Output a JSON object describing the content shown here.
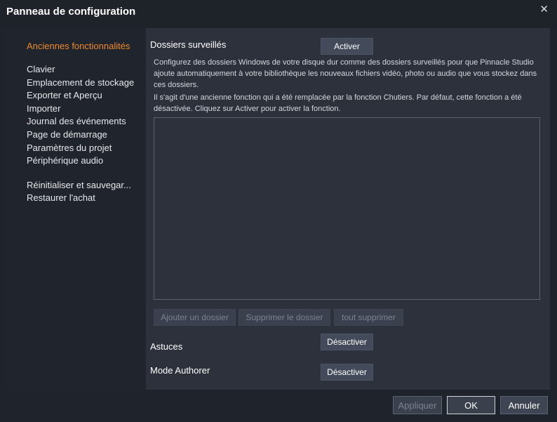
{
  "window": {
    "title": "Panneau de configuration",
    "close_icon": "close-icon"
  },
  "sidebar": {
    "items": [
      {
        "label": "Anciennes fonctionnalités",
        "active": true
      },
      {
        "label": "Clavier"
      },
      {
        "label": "Emplacement de stockage"
      },
      {
        "label": "Exporter et Aperçu"
      },
      {
        "label": "Importer"
      },
      {
        "label": "Journal des événements"
      },
      {
        "label": "Page de démarrage"
      },
      {
        "label": "Paramètres du projet"
      },
      {
        "label": "Périphérique audio"
      },
      {
        "label": "Réinitialiser et sauvegar..."
      },
      {
        "label": "Restaurer l'achat"
      }
    ]
  },
  "watched_folders": {
    "title": "Dossiers surveillés",
    "activate_label": "Activer",
    "description_1": "Configurez des dossiers Windows de votre disque dur comme des dossiers surveillés pour que Pinnacle Studio ajoute automatiquement à votre bibliothèque les nouveaux fichiers vidéo, photo ou audio que vous stockez dans ces dossiers.",
    "description_2": "Il s'agit d'une ancienne fonction qui a été remplacée par la fonction Chutiers. Par défaut, cette fonction a été désactivée. Cliquez sur Activer pour activer la fonction.",
    "add_folder_label": "Ajouter un dossier",
    "remove_folder_label": "Supprimer le dossier",
    "remove_all_label": "tout supprimer"
  },
  "tips": {
    "title": "Astuces",
    "deactivate_label": "Désactiver"
  },
  "authorer": {
    "title": "Mode Authorer",
    "deactivate_label": "Désactiver"
  },
  "footer": {
    "apply_label": "Appliquer",
    "ok_label": "OK",
    "cancel_label": "Annuler"
  },
  "colors": {
    "accent": "#f0892b",
    "background": "#2c313c",
    "sidebar": "#20242c"
  }
}
